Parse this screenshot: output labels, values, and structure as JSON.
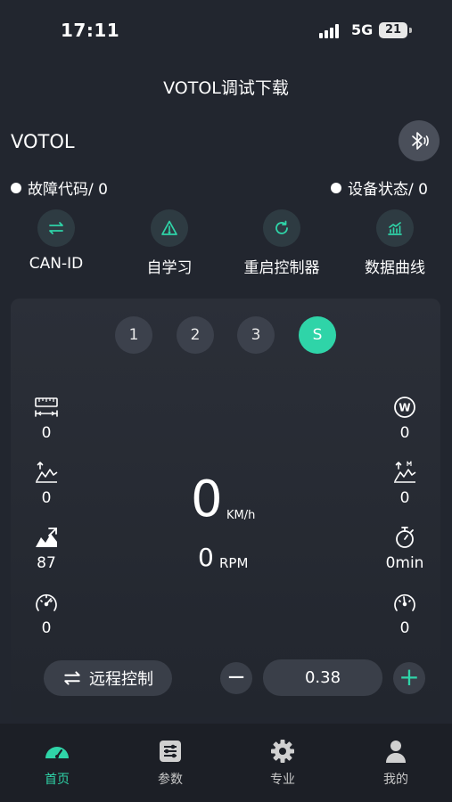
{
  "status_bar": {
    "time": "17:11",
    "network": "5G",
    "battery": "21"
  },
  "app_title": "VOTOL调试下载",
  "device_name": "VOTOL",
  "fault": {
    "label": "故障代码/ 0"
  },
  "device_status": {
    "label": "设备状态/ 0"
  },
  "quick_actions": [
    {
      "label": "CAN-ID",
      "icon": "swap-arrows-icon"
    },
    {
      "label": "自学习",
      "icon": "warning-icon"
    },
    {
      "label": "重启控制器",
      "icon": "refresh-icon"
    },
    {
      "label": "数据曲线",
      "icon": "chart-icon"
    }
  ],
  "gears": [
    "1",
    "2",
    "3",
    "S"
  ],
  "active_gear": "S",
  "left_metrics": [
    {
      "icon": "odometer-ruler-icon",
      "value": "0"
    },
    {
      "icon": "peak-chart-icon",
      "value": "0"
    },
    {
      "icon": "mountain-chart-icon",
      "value": "87"
    },
    {
      "icon": "speedometer-icon",
      "value": "0"
    }
  ],
  "right_metrics": [
    {
      "icon": "power-w-icon",
      "value": "0"
    },
    {
      "icon": "peak-max-icon",
      "value": "0"
    },
    {
      "icon": "stopwatch-icon",
      "value": "0min"
    },
    {
      "icon": "speedometer-icon",
      "value": "0"
    }
  ],
  "speed": {
    "value": "0",
    "unit": "KM/h"
  },
  "rpm": {
    "value": "0",
    "unit": "RPM"
  },
  "remote_control": {
    "label": "远程控制"
  },
  "adjust_value": "0.38",
  "tabs": [
    {
      "label": "首页",
      "icon": "dashboard-icon",
      "active": true
    },
    {
      "label": "参数",
      "icon": "sliders-icon",
      "active": false
    },
    {
      "label": "专业",
      "icon": "gear-icon",
      "active": false
    },
    {
      "label": "我的",
      "icon": "user-icon",
      "active": false
    }
  ],
  "colors": {
    "accent": "#2fd4a8",
    "background": "#22262f",
    "panel": "#2b2f38"
  }
}
